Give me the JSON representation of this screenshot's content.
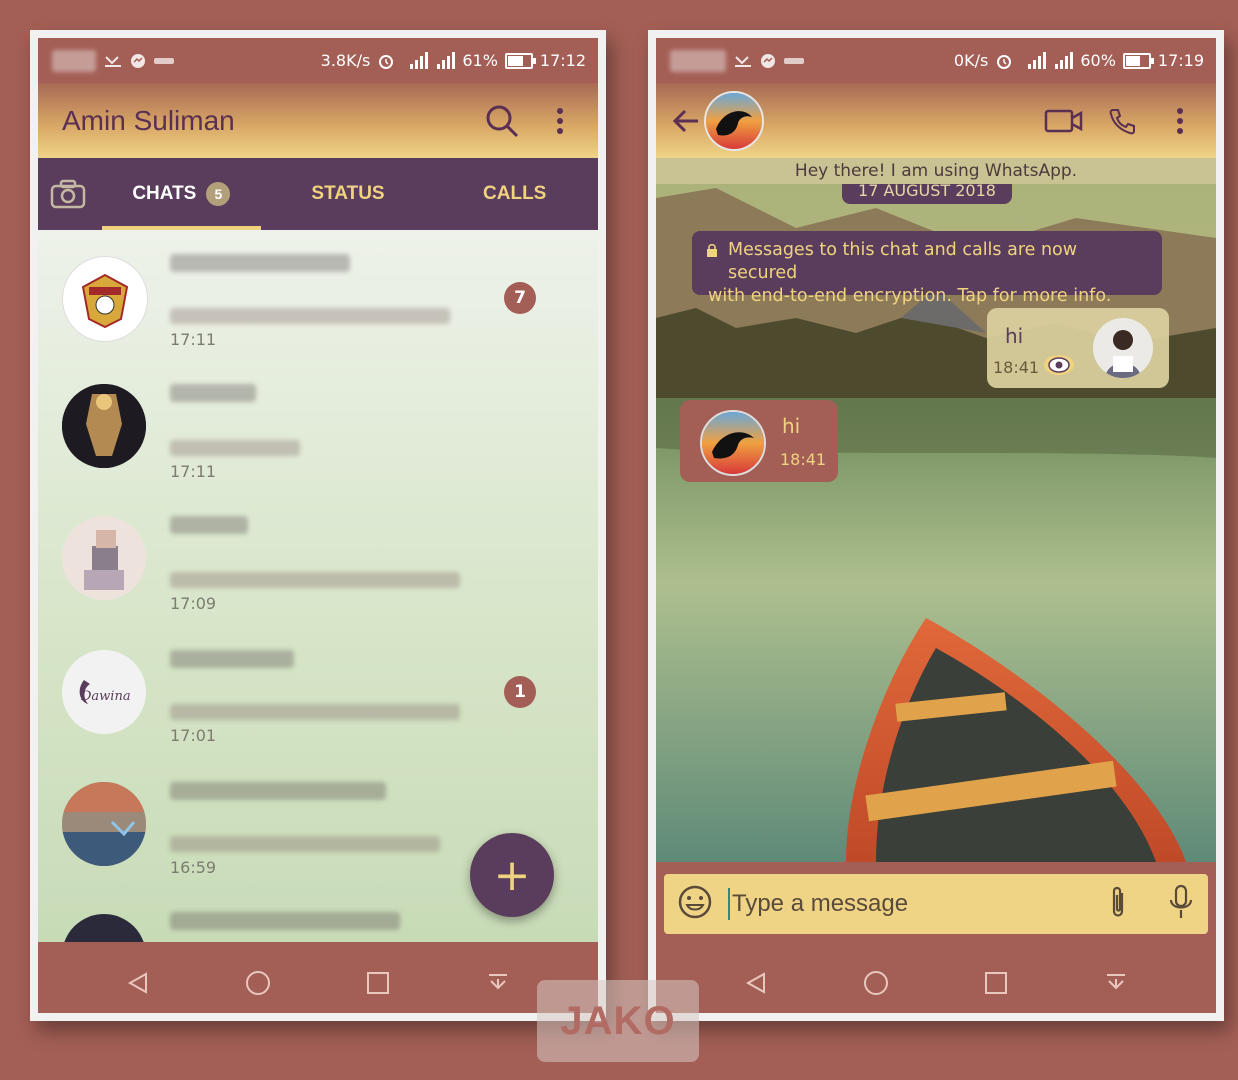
{
  "left_screen": {
    "status": {
      "speed": "3.8K/s",
      "battery": "61%",
      "battery_level": 0.61,
      "time": "17:12"
    },
    "header": {
      "title": "Amin Suliman"
    },
    "tabs": {
      "chats": "CHATS",
      "chats_badge": "5",
      "status": "STATUS",
      "calls": "CALLS"
    },
    "chats": [
      {
        "time": "17:11",
        "unread": "7"
      },
      {
        "time": "17:11",
        "unread": ""
      },
      {
        "time": "17:09",
        "unread": ""
      },
      {
        "time": "17:01",
        "unread": "1",
        "avatar_text": "Dawina"
      },
      {
        "time": "16:59",
        "unread": ""
      }
    ],
    "fab": {
      "icon": "plus-icon",
      "label": "+"
    }
  },
  "right_screen": {
    "status": {
      "speed": "0K/s",
      "battery": "60%",
      "battery_level": 0.6,
      "time": "17:19"
    },
    "about": "Hey there! I am using WhatsApp.",
    "date_chip": "17 AUGUST 2018",
    "encryption_line1": "Messages to this chat and calls are now secured",
    "encryption_line2": "with end-to-end encryption. Tap for more info.",
    "outgoing": {
      "text": "hi",
      "time": "18:41"
    },
    "incoming": {
      "text": "hi",
      "time": "18:41"
    },
    "input_placeholder": "Type a message"
  },
  "watermark": "JAKO",
  "colors": {
    "accent": "#5a3d5c",
    "gold": "#f0d37f",
    "brick": "#a35f56"
  }
}
